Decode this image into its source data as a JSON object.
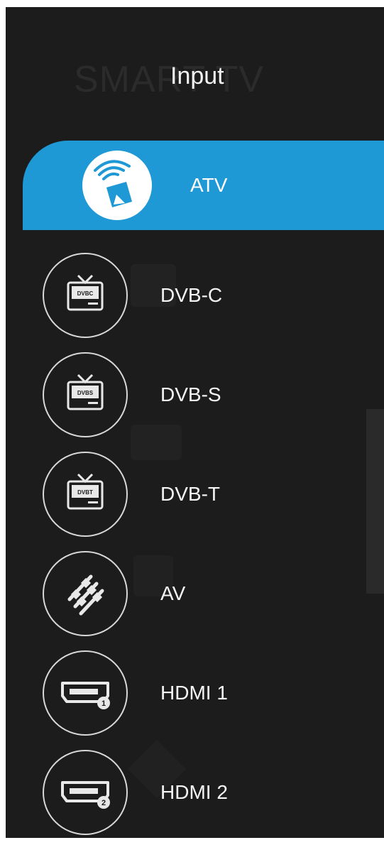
{
  "background_text": "SMART TV",
  "panel": {
    "title": "Input"
  },
  "selected": {
    "label": "ATV",
    "icon": "satellite-dish-icon"
  },
  "items": [
    {
      "label": "DVB-C",
      "icon": "dvbc-tv-icon",
      "icon_text": "DVBC"
    },
    {
      "label": "DVB-S",
      "icon": "dvbs-tv-icon",
      "icon_text": "DVBS"
    },
    {
      "label": "DVB-T",
      "icon": "dvbt-tv-icon",
      "icon_text": "DVBT"
    },
    {
      "label": "AV",
      "icon": "av-cables-icon"
    },
    {
      "label": "HDMI 1",
      "icon": "hdmi-port-icon",
      "icon_text": "1"
    },
    {
      "label": "HDMI 2",
      "icon": "hdmi-port-icon",
      "icon_text": "2"
    }
  ],
  "colors": {
    "background": "#1c1c1c",
    "accent": "#1f98d6",
    "text": "#f5f5f5"
  }
}
